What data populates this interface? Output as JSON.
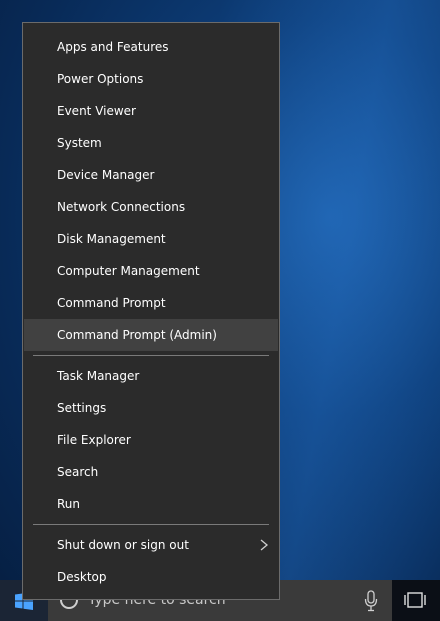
{
  "menu": {
    "group1": [
      {
        "label": "Apps and Features"
      },
      {
        "label": "Power Options"
      },
      {
        "label": "Event Viewer"
      },
      {
        "label": "System"
      },
      {
        "label": "Device Manager"
      },
      {
        "label": "Network Connections"
      },
      {
        "label": "Disk Management"
      },
      {
        "label": "Computer Management"
      },
      {
        "label": "Command Prompt"
      },
      {
        "label": "Command Prompt (Admin)",
        "highlighted": true
      }
    ],
    "group2": [
      {
        "label": "Task Manager"
      },
      {
        "label": "Settings"
      },
      {
        "label": "File Explorer"
      },
      {
        "label": "Search"
      },
      {
        "label": "Run"
      }
    ],
    "group3": [
      {
        "label": "Shut down or sign out",
        "has_submenu": true
      },
      {
        "label": "Desktop"
      }
    ]
  },
  "taskbar": {
    "search_placeholder": "Type here to search",
    "start_icon": "windows-logo-icon",
    "mic_icon": "microphone-icon",
    "task_view_icon": "task-view-icon"
  },
  "colors": {
    "menu_bg": "#2b2b2b",
    "highlight_bg": "#414141",
    "accent": "#0078d7"
  }
}
